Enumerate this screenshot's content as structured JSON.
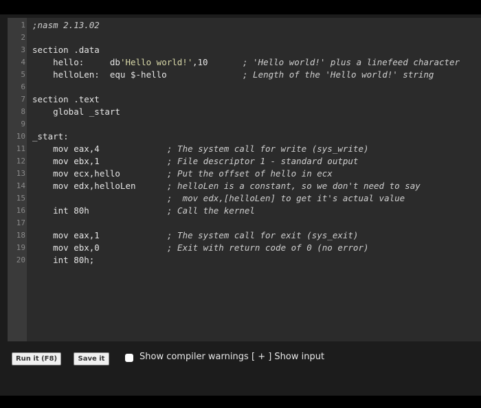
{
  "editor": {
    "line_numbers": [
      "1",
      "2",
      "3",
      "4",
      "5",
      "6",
      "7",
      "8",
      "9",
      "10",
      "11",
      "12",
      "13",
      "14",
      "15",
      "16",
      "17",
      "18",
      "19",
      "20"
    ],
    "lines": [
      {
        "code": ";nasm 2.13.02",
        "comment": ""
      },
      {
        "code": "",
        "comment": ""
      },
      {
        "code": "section .data",
        "comment": ""
      },
      {
        "code": "    hello:     db ",
        "str": "'Hello world!'",
        "tail": ",10",
        "comment": "; 'Hello world!' plus a linefeed character"
      },
      {
        "code": "    helloLen:  equ $-hello",
        "comment": "; Length of the 'Hello world!' string"
      },
      {
        "code": "",
        "comment": ""
      },
      {
        "code": "section .text",
        "comment": ""
      },
      {
        "code": "    global _start",
        "comment": ""
      },
      {
        "code": "",
        "comment": ""
      },
      {
        "code": "_start:",
        "comment": ""
      },
      {
        "code": "    mov eax,4",
        "comment": "; The system call for write (sys_write)"
      },
      {
        "code": "    mov ebx,1",
        "comment": "; File descriptor 1 - standard output"
      },
      {
        "code": "    mov ecx,hello",
        "comment": "; Put the offset of hello in ecx"
      },
      {
        "code": "    mov edx,helloLen",
        "comment": "; helloLen is a constant, so we don't need to say"
      },
      {
        "code": "",
        "comment": ";  mov edx,[helloLen] to get it's actual value"
      },
      {
        "code": "    int 80h",
        "comment": "; Call the kernel"
      },
      {
        "code": "",
        "comment": ""
      },
      {
        "code": "    mov eax,1",
        "comment": "; The system call for exit (sys_exit)"
      },
      {
        "code": "    mov ebx,0",
        "comment": "; Exit with return code of 0 (no error)"
      },
      {
        "code": "    int 80h;",
        "comment": ""
      }
    ]
  },
  "toolbar": {
    "run_label": "Run it (F8)",
    "save_label": "Save it",
    "warnings_label": "Show compiler warnings",
    "show_input_label": "[ + ] Show input"
  }
}
